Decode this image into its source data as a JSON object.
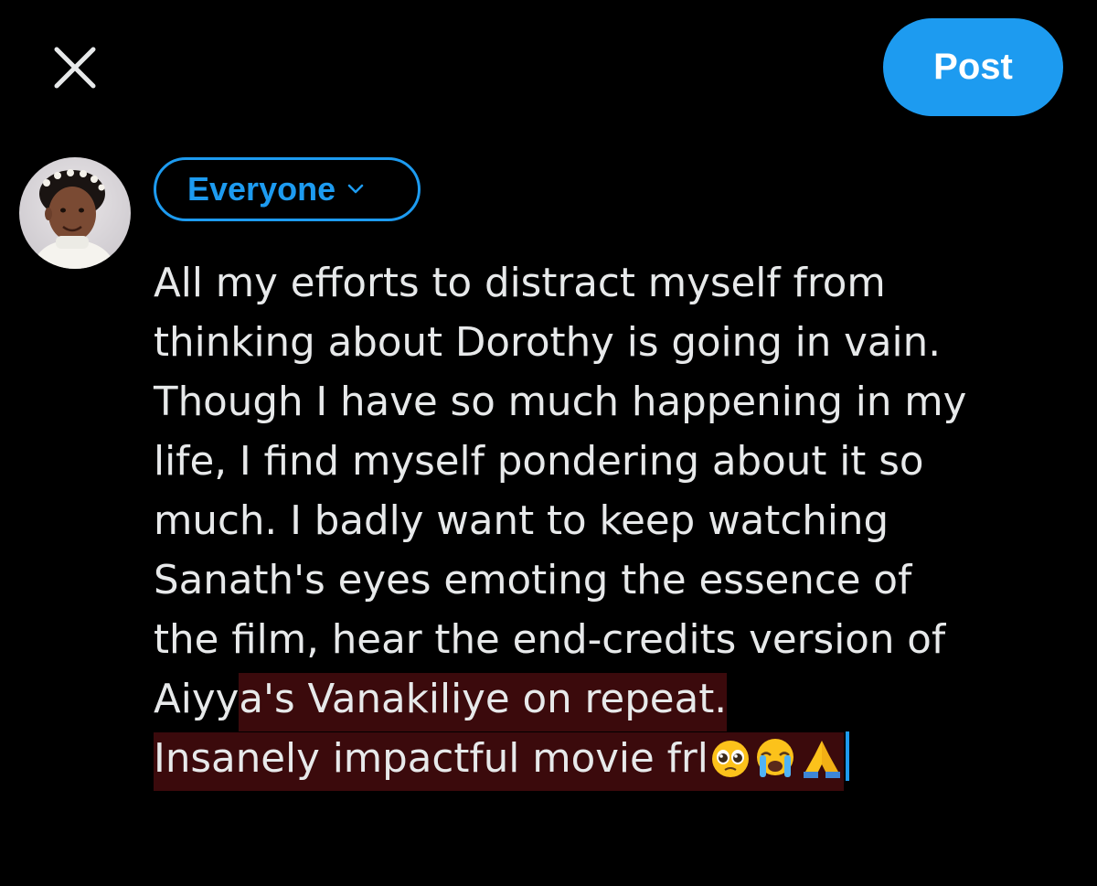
{
  "header": {
    "close_icon": "close-icon",
    "post_label": "Post"
  },
  "composer": {
    "avatar": "avatar",
    "audience_label": "Everyone",
    "audience_icon": "chevron-down-icon",
    "lines": [
      "All my efforts to distract myself from",
      "thinking about Dorothy is going in vain.",
      "Though I have so much happening in my",
      "life, I find myself pondering about it so",
      "much. I badly want to keep watching",
      "Sanath's eyes emoting the essence of",
      "the film,  hear the end-credits version of"
    ],
    "line8_plain": "Aiyy",
    "line8_highlight": "a's Vanakiliye on repeat. ",
    "line9_text": "Insanely impactful movie frl",
    "emojis": [
      "pleading-face-emoji",
      "loudly-crying-face-emoji",
      "folded-hands-emoji"
    ],
    "highlight_color": "#3b0a0c",
    "accent": "#1d9bf0"
  }
}
